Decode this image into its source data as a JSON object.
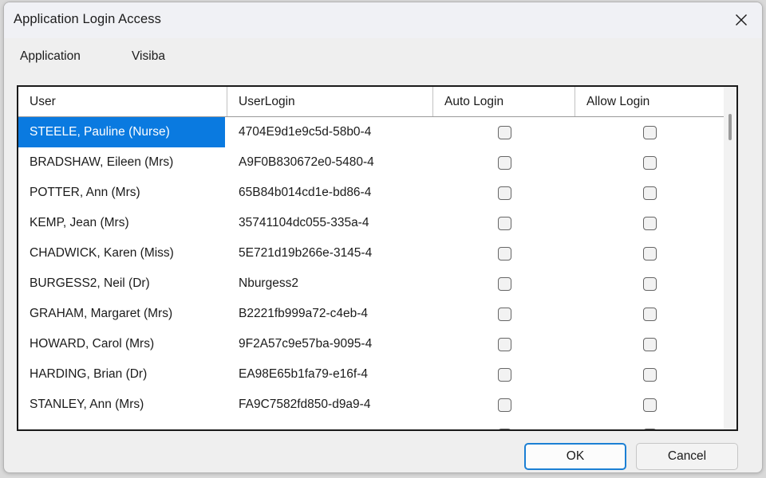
{
  "window": {
    "title": "Application Login Access",
    "close_icon": "close-icon"
  },
  "menubar": {
    "items": [
      {
        "label": "Application"
      },
      {
        "label": "Visiba"
      }
    ]
  },
  "grid": {
    "columns": [
      "User",
      "UserLogin",
      "Auto Login",
      "Allow Login"
    ],
    "rows": [
      {
        "user": "STEELE, Pauline (Nurse)",
        "login": "4704E9d1e9c5d-58b0-4",
        "auto_login": false,
        "allow_login": false,
        "selected": true
      },
      {
        "user": "BRADSHAW, Eileen (Mrs)",
        "login": "A9F0B830672e0-5480-4",
        "auto_login": false,
        "allow_login": false,
        "selected": false
      },
      {
        "user": "POTTER, Ann (Mrs)",
        "login": "65B84b014cd1e-bd86-4",
        "auto_login": false,
        "allow_login": false,
        "selected": false
      },
      {
        "user": "KEMP, Jean (Mrs)",
        "login": "35741104dc055-335a-4",
        "auto_login": false,
        "allow_login": false,
        "selected": false
      },
      {
        "user": "CHADWICK, Karen (Miss)",
        "login": "5E721d19b266e-3145-4",
        "auto_login": false,
        "allow_login": false,
        "selected": false
      },
      {
        "user": "BURGESS2, Neil (Dr)",
        "login": "Nburgess2",
        "auto_login": false,
        "allow_login": false,
        "selected": false
      },
      {
        "user": "GRAHAM, Margaret (Mrs)",
        "login": "B2221fb999a72-c4eb-4",
        "auto_login": false,
        "allow_login": false,
        "selected": false
      },
      {
        "user": "HOWARD, Carol (Mrs)",
        "login": "9F2A57c9e57ba-9095-4",
        "auto_login": false,
        "allow_login": false,
        "selected": false
      },
      {
        "user": "HARDING, Brian (Dr)",
        "login": "EA98E65b1fa79-e16f-4",
        "auto_login": false,
        "allow_login": false,
        "selected": false
      },
      {
        "user": "STANLEY, Ann (Mrs)",
        "login": "FA9C7582fd850-d9a9-4",
        "auto_login": false,
        "allow_login": false,
        "selected": false
      },
      {
        "user": "",
        "login": "",
        "auto_login": false,
        "allow_login": false,
        "selected": false
      }
    ]
  },
  "buttons": {
    "ok": "OK",
    "cancel": "Cancel"
  },
  "colors": {
    "selection": "#0a7ae0",
    "focus_border": "#1b7fd4",
    "titlebar": "#f0f1f5",
    "body": "#efefef"
  }
}
